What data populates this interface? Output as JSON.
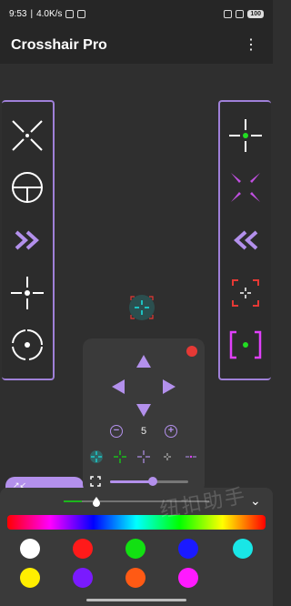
{
  "status": {
    "time": "9:53",
    "speed": "4.0K/s",
    "battery": "100"
  },
  "appbar": {
    "title": "Crosshair Pro",
    "menu_icon": "more-vert-icon"
  },
  "left_panel": {
    "items": [
      "x-cross-icon",
      "circle-scope-icon",
      "double-chevron-right-icon",
      "dot-crosshair-icon",
      "circle-gap-icon"
    ]
  },
  "right_panel": {
    "items": [
      "green-dot-crosshair-icon",
      "purple-x-icon",
      "double-chevron-left-icon",
      "red-corner-bracket-icon",
      "magenta-bracket-dot-icon"
    ]
  },
  "control_panel": {
    "size_value": "5",
    "minus_label": "−",
    "plus_label": "+"
  },
  "colors": {
    "accent": "#b390ec",
    "background": "#2f2f2f",
    "close": "#e53935",
    "swatches": [
      "#ffffff",
      "#ff1a1a",
      "#12e012",
      "#1a1aff",
      "#19e6e6",
      "#ffee00",
      "#7a1aff",
      "#ff5a14",
      "#ff1aff"
    ]
  },
  "sliders": {
    "size_fraction": 0.55,
    "opacity_fraction": 0.2,
    "hue_fraction": 0.5
  },
  "watermark": "纽扣助手"
}
